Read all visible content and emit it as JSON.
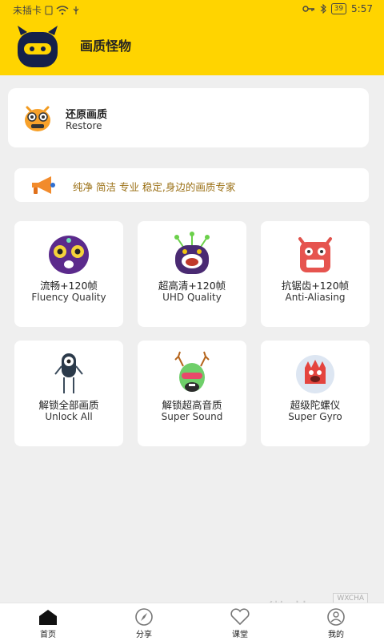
{
  "status_bar": {
    "carrier": "未插卡",
    "time": "5:57",
    "battery": "39"
  },
  "header": {
    "title": "画质怪物"
  },
  "restore": {
    "title": "还原画质",
    "subtitle": "Restore"
  },
  "notice": {
    "text": "纯净 简洁 专业 稳定,身边的画质专家"
  },
  "features": [
    {
      "name": "流畅+120帧",
      "sub": "Fluency Quality",
      "icon": "purple-monster-icon"
    },
    {
      "name": "超高清+120帧",
      "sub": "UHD Quality",
      "icon": "antenna-monster-icon"
    },
    {
      "name": "抗锯齿+120帧",
      "sub": "Anti-Aliasing",
      "icon": "red-box-monster-icon"
    },
    {
      "name": "解锁全部画质",
      "sub": "Unlock All",
      "icon": "one-eye-monster-icon"
    },
    {
      "name": "解锁超高音质",
      "sub": "Super Sound",
      "icon": "antler-monster-icon"
    },
    {
      "name": "超级陀螺仪",
      "sub": "Super Gyro",
      "icon": "bubble-monster-icon"
    }
  ],
  "bottom_nav": [
    {
      "label": "首页",
      "icon": "home-icon"
    },
    {
      "label": "分享",
      "icon": "compass-icon"
    },
    {
      "label": "课堂",
      "icon": "heart-icon"
    },
    {
      "label": "我的",
      "icon": "profile-icon"
    }
  ],
  "watermark": {
    "text": "微茶",
    "badge": "WXCHA"
  },
  "colors": {
    "brand_yellow": "#ffd400",
    "notice_text": "#9a6f14"
  }
}
